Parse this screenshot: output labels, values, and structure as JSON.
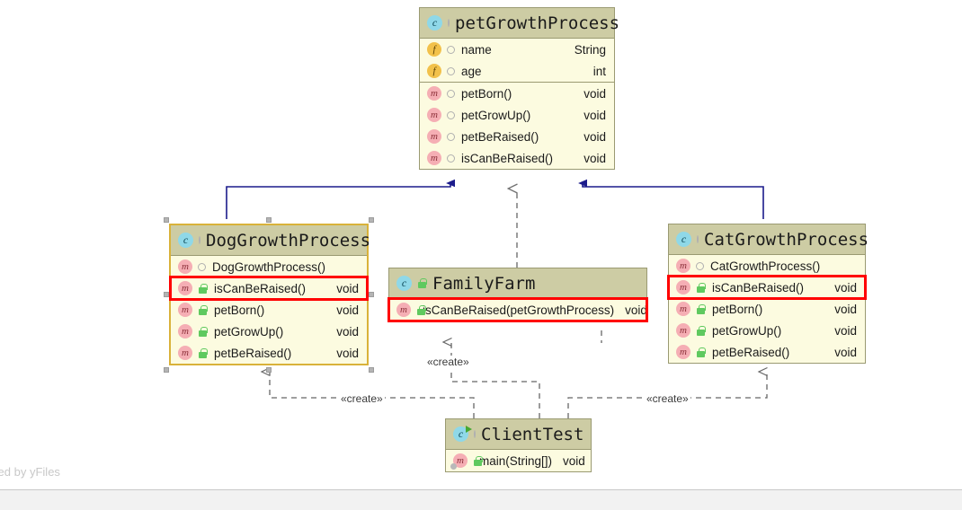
{
  "diagram": {
    "watermark": "ered by yFiles",
    "colors": {
      "node_header": "#cdcca4",
      "node_body": "#fcfbe0",
      "node_border": "#9a9a72",
      "selected_border": "#d9b23a",
      "highlight": "#ff0000",
      "inheritance_edge": "#1c1c8c",
      "dependency_edge": "#555555",
      "class_icon": "#8fd8e8",
      "field_icon": "#f2c14b",
      "method_icon": "#f5aeb4",
      "public_lock": "#5fc95f"
    },
    "nodes": [
      {
        "id": "petGrowthProcess",
        "title": "petGrowthProcess",
        "icon": "class-icon",
        "title_visibility": "package-icon",
        "selected": false,
        "sections": [
          {
            "rows": [
              {
                "icon": "field-icon",
                "visibility": "package-icon",
                "name": "name",
                "type": "String",
                "highlight": false
              },
              {
                "icon": "field-icon",
                "visibility": "package-icon",
                "name": "age",
                "type": "int",
                "highlight": false
              }
            ]
          },
          {
            "rows": [
              {
                "icon": "method-icon",
                "visibility": "package-icon",
                "name": "petBorn()",
                "type": "void",
                "highlight": false
              },
              {
                "icon": "method-icon",
                "visibility": "package-icon",
                "name": "petGrowUp()",
                "type": "void",
                "highlight": false
              },
              {
                "icon": "method-icon",
                "visibility": "package-icon",
                "name": "petBeRaised()",
                "type": "void",
                "highlight": false
              },
              {
                "icon": "method-icon",
                "visibility": "package-icon",
                "name": "isCanBeRaised()",
                "type": "void",
                "highlight": false
              }
            ]
          }
        ]
      },
      {
        "id": "DogGrowthProcess",
        "title": "DogGrowthProcess",
        "icon": "class-icon",
        "title_visibility": "package-icon",
        "selected": true,
        "sections": [
          {
            "rows": [
              {
                "icon": "method-icon",
                "visibility": "package-icon",
                "name": "DogGrowthProcess()",
                "type": "",
                "highlight": false
              },
              {
                "icon": "method-icon",
                "visibility": "public-lock-icon",
                "name": "isCanBeRaised()",
                "type": "void",
                "highlight": true
              },
              {
                "icon": "method-icon",
                "visibility": "public-lock-icon",
                "name": "petBorn()",
                "type": "void",
                "highlight": false
              },
              {
                "icon": "method-icon",
                "visibility": "public-lock-icon",
                "name": "petGrowUp()",
                "type": "void",
                "highlight": false
              },
              {
                "icon": "method-icon",
                "visibility": "public-lock-icon",
                "name": "petBeRaised()",
                "type": "void",
                "highlight": false
              }
            ]
          }
        ]
      },
      {
        "id": "CatGrowthProcess",
        "title": "CatGrowthProcess",
        "icon": "class-icon",
        "title_visibility": "package-icon",
        "selected": false,
        "sections": [
          {
            "rows": [
              {
                "icon": "method-icon",
                "visibility": "package-icon",
                "name": "CatGrowthProcess()",
                "type": "",
                "highlight": false
              },
              {
                "icon": "method-icon",
                "visibility": "public-lock-icon",
                "name": "isCanBeRaised()",
                "type": "void",
                "highlight": true
              },
              {
                "icon": "method-icon",
                "visibility": "public-lock-icon",
                "name": "petBorn()",
                "type": "void",
                "highlight": false
              },
              {
                "icon": "method-icon",
                "visibility": "public-lock-icon",
                "name": "petGrowUp()",
                "type": "void",
                "highlight": false
              },
              {
                "icon": "method-icon",
                "visibility": "public-lock-icon",
                "name": "petBeRaised()",
                "type": "void",
                "highlight": false
              }
            ]
          }
        ]
      },
      {
        "id": "FamilyFarm",
        "title": "FamilyFarm",
        "icon": "class-icon",
        "title_visibility": "public-lock-icon",
        "selected": false,
        "sections": [
          {
            "rows": [
              {
                "icon": "method-icon",
                "visibility": "public-lock-icon",
                "name": "isCanBeRaised(petGrowthProcess)",
                "type": "void",
                "highlight": true
              }
            ]
          }
        ]
      },
      {
        "id": "ClientTest",
        "title": "ClientTest",
        "icon": "class-runnable-icon",
        "title_visibility": "package-icon",
        "selected": false,
        "sections": [
          {
            "rows": [
              {
                "icon": "method-run-icon",
                "visibility": "public-lock-icon",
                "name": "main(String[])",
                "type": "void",
                "highlight": false
              }
            ]
          }
        ]
      }
    ],
    "edge_labels": [
      {
        "id": "create-left",
        "text": "«create»"
      },
      {
        "id": "create-middle",
        "text": "«create»"
      },
      {
        "id": "create-right",
        "text": "«create»"
      }
    ]
  }
}
